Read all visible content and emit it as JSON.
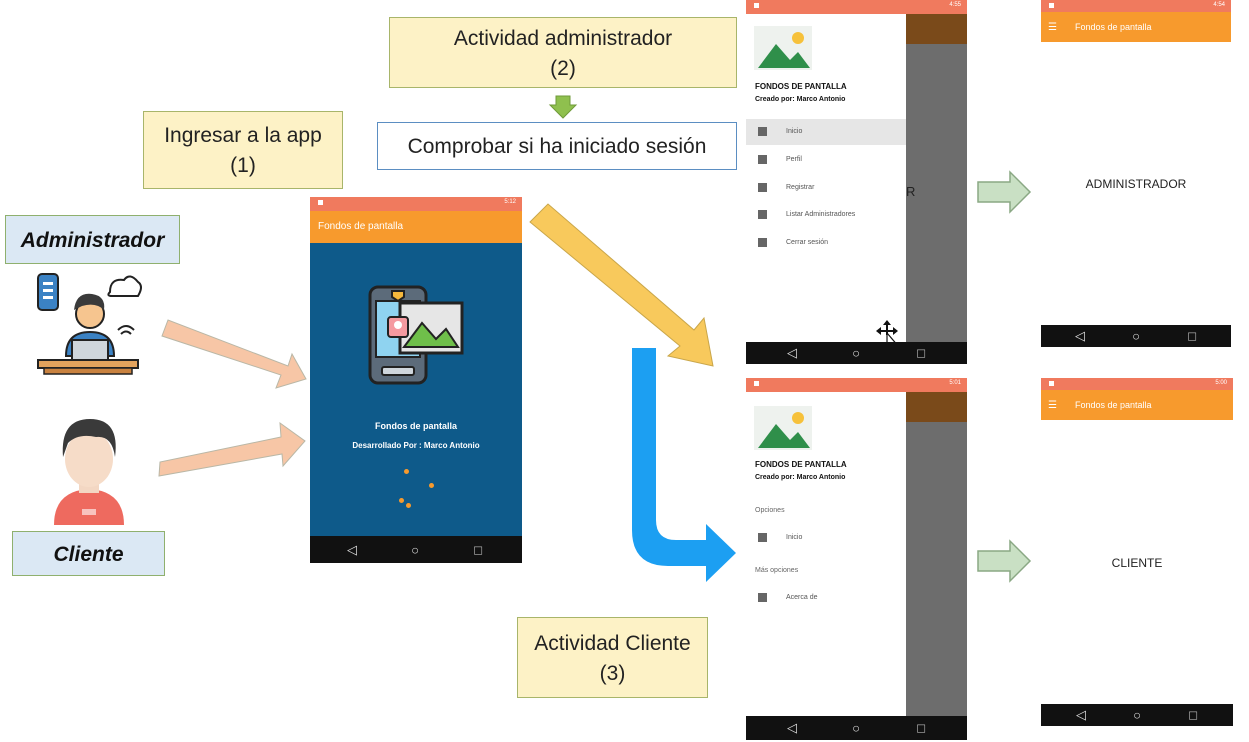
{
  "notes": {
    "ingresar": {
      "line1": "Ingresar a la app",
      "line2": "(1)"
    },
    "admin_activity": {
      "line1": "Actividad administrador",
      "line2": "(2)"
    },
    "check_session": "Comprobar si ha iniciado sesión",
    "client_activity": {
      "line1": "Actividad Cliente",
      "line2": "(3)"
    }
  },
  "roles": {
    "admin": "Administrador",
    "client": "Cliente"
  },
  "splash": {
    "time": "5:12",
    "toolbar_title": "Fondos de pantalla",
    "app_name": "Fondos de pantalla",
    "developer": "Desarrollado Por : Marco Antonio"
  },
  "admin_drawer": {
    "time": "4:55",
    "app_title": "FONDOS DE PANTALLA",
    "created_by": "Creado por: Marco Antonio",
    "items": [
      "Inicio",
      "Perfil",
      "Registrar",
      "Listar Administradores",
      "Cerrar sesión"
    ],
    "overlay_letter": "R"
  },
  "admin_screen": {
    "time": "4:54",
    "toolbar_title": "Fondos de pantalla",
    "label": "ADMINISTRADOR"
  },
  "client_drawer": {
    "time": "5:01",
    "app_title": "FONDOS DE PANTALLA",
    "created_by": "Creado por: Marco Antonio",
    "section1": "Opciones",
    "item1": "Inicio",
    "section2": "Más opciones",
    "item2": "Acerca de"
  },
  "client_screen": {
    "time": "5:00",
    "toolbar_title": "Fondos de pantalla",
    "label": "CLIENTE"
  },
  "nav_icons": {
    "back": "◁",
    "home": "○",
    "recent": "□"
  },
  "colors": {
    "toolbar": "#f79a2d",
    "status": "#f07a5e",
    "splash_bg": "#0e5a8a",
    "note_bg": "#fdf2c6"
  }
}
